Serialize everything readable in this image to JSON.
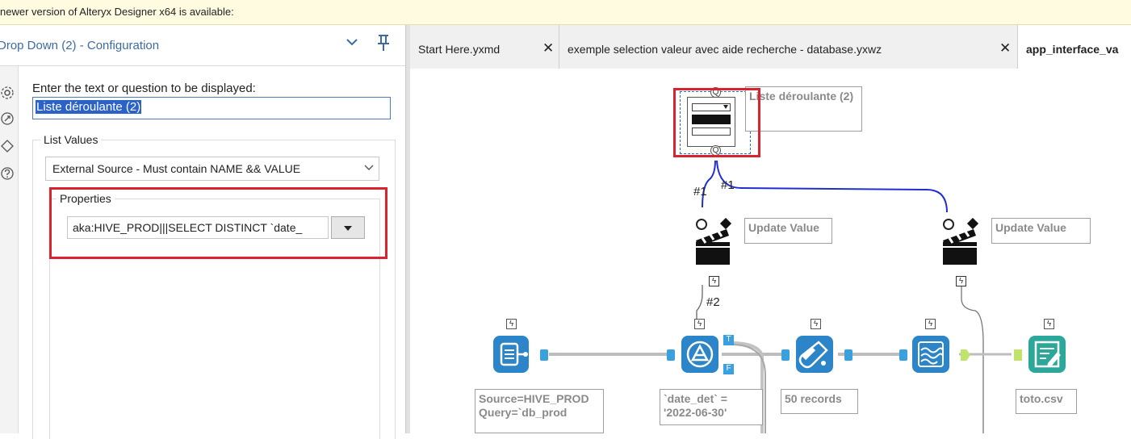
{
  "banner": {
    "text": "newer version of Alteryx Designer x64 is available:"
  },
  "config": {
    "title": "Drop Down (2) - Configuration",
    "prompt_label": "Enter the text or question to be displayed:",
    "prompt_value": "Liste déroulante (2)",
    "list_values_legend": "List Values",
    "source_option": "External Source - Must contain NAME && VALUE",
    "properties_legend": "Properties",
    "query_value": "aka:HIVE_PROD|||SELECT DISTINCT `date_"
  },
  "tabs": [
    {
      "label": "Start Here.yxmd"
    },
    {
      "label": "exemple selection valeur avec aide recherche - database.yxwz"
    },
    {
      "label": "app_interface_va"
    }
  ],
  "canvas": {
    "dropdown_label": "Liste déroulante (2)",
    "update_value_1": "Update Value",
    "update_value_2": "Update Value",
    "conn_1a": "#1",
    "conn_1b": "#1",
    "conn_2": "#2",
    "input_label": "Source=HIVE_PROD Query=`db_prod",
    "filter_label": "`date_det` = '2022-06-30'",
    "sample_label": "50 records",
    "output_label": "toto.csv",
    "anchor_q": "Q",
    "anchor_t": "T",
    "anchor_f": "F"
  },
  "colors": {
    "accent": "#3d6aa5",
    "highlight_box": "#d9232e",
    "connection_blue": "#1f2fd1",
    "tool_blue": "#2b85c8",
    "tool_green": "#2ca89a"
  },
  "icons": {
    "collapse": "chevron-down-icon",
    "pin": "pin-icon",
    "configuration": "gear-icon",
    "annotation": "annotation-icon",
    "meta": "tag-icon",
    "help": "help-icon",
    "tab_close": "close-icon",
    "anchor_question": "question-anchor-icon",
    "lightning": "lightning-icon"
  }
}
